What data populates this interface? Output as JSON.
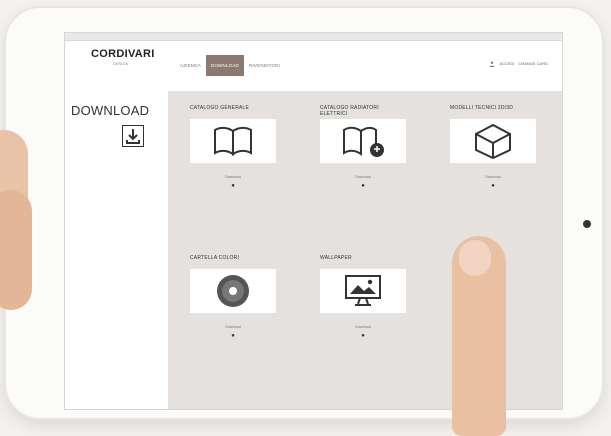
{
  "brand": {
    "name": "CORDIVARI",
    "tagline": "DESIGN"
  },
  "nav": {
    "items": [
      "AZIENDA",
      "DOWNLOAD",
      "RIVENDITORI"
    ],
    "active_index": 1
  },
  "topright": {
    "links": [
      "ACCEDI",
      "CHANGE CARD"
    ]
  },
  "sidebar": {
    "title": "DOWNLOAD"
  },
  "cards": [
    {
      "title": "CATALOGO GENERALE",
      "meta": "Download",
      "icon": "open-book-icon"
    },
    {
      "title": "CATALOGO RADIATORI ELETTRICI",
      "meta": "Download",
      "icon": "book-with-plug-icon"
    },
    {
      "title": "MODELLI TECNICI 2D/3D",
      "meta": "Download",
      "icon": "cube-icon"
    },
    {
      "title": "CARTELLA COLORI",
      "meta": "Download",
      "icon": "disc-icon"
    },
    {
      "title": "WALLPAPER",
      "meta": "Download",
      "icon": "monitor-picture-icon"
    }
  ],
  "colors": {
    "accent": "#8c7a70",
    "panel": "#e4e1de",
    "text": "#333333"
  }
}
